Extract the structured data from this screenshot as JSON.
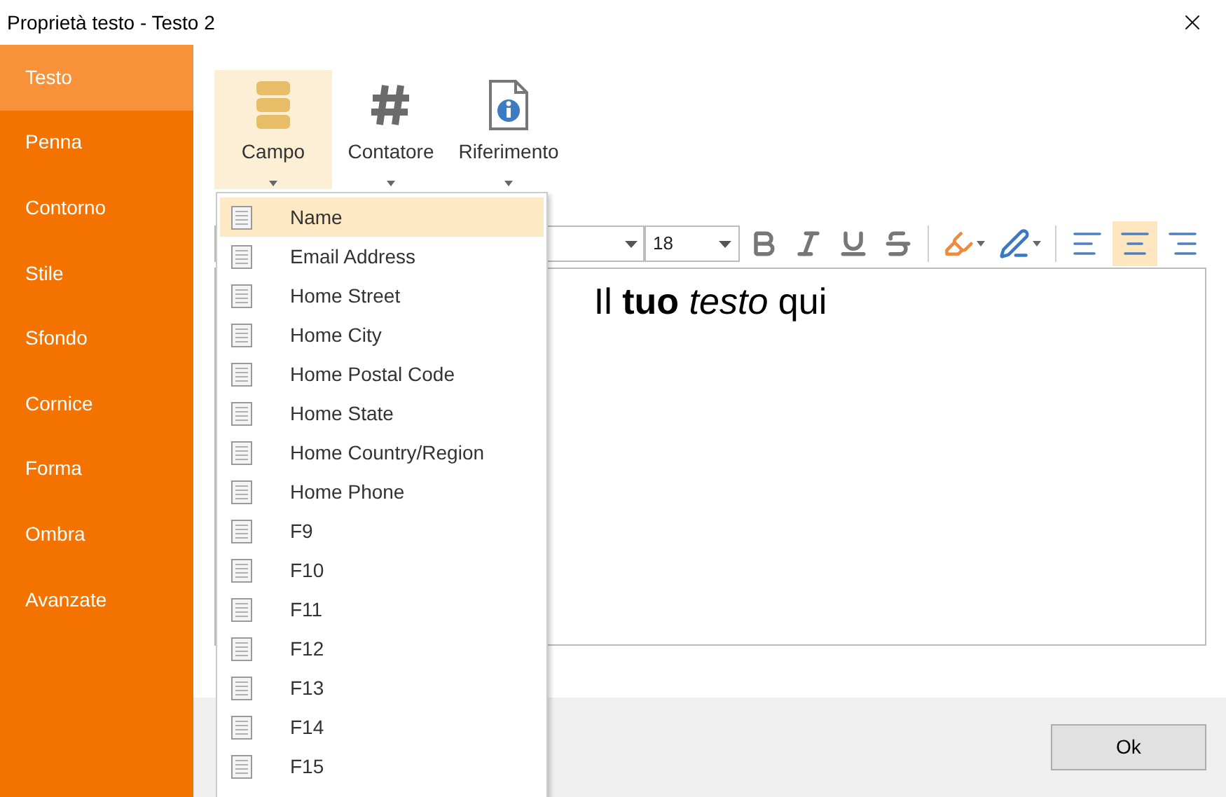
{
  "window": {
    "title": "Proprietà testo - Testo 2"
  },
  "sidebar": {
    "items": [
      {
        "label": "Testo",
        "selected": true
      },
      {
        "label": "Penna",
        "selected": false
      },
      {
        "label": "Contorno",
        "selected": false
      },
      {
        "label": "Stile",
        "selected": false
      },
      {
        "label": "Sfondo",
        "selected": false
      },
      {
        "label": "Cornice",
        "selected": false
      },
      {
        "label": "Forma",
        "selected": false
      },
      {
        "label": "Ombra",
        "selected": false
      },
      {
        "label": "Avanzate",
        "selected": false
      }
    ]
  },
  "ribbon": {
    "buttons": [
      {
        "label": "Campo",
        "kind": "field",
        "selected": true
      },
      {
        "label": "Contatore",
        "kind": "counter",
        "selected": false
      },
      {
        "label": "Riferimento",
        "kind": "reference",
        "selected": false
      }
    ]
  },
  "toolbar": {
    "font_size": "18",
    "format_buttons": [
      {
        "kind": "bold"
      },
      {
        "kind": "italic"
      },
      {
        "kind": "underline"
      },
      {
        "kind": "strike"
      }
    ],
    "color_buttons": [
      {
        "kind": "highlight"
      },
      {
        "kind": "pen"
      }
    ],
    "align_buttons": [
      {
        "kind": "left",
        "selected": false
      },
      {
        "kind": "center",
        "selected": true
      },
      {
        "kind": "right",
        "selected": false
      }
    ]
  },
  "editor": {
    "text": "Il **tuo** *testo* qui"
  },
  "field_menu": {
    "items": [
      {
        "label": "Name",
        "selected": true
      },
      {
        "label": "Email Address",
        "selected": false
      },
      {
        "label": "Home Street",
        "selected": false
      },
      {
        "label": "Home City",
        "selected": false
      },
      {
        "label": "Home Postal Code",
        "selected": false
      },
      {
        "label": "Home State",
        "selected": false
      },
      {
        "label": "Home Country/Region",
        "selected": false
      },
      {
        "label": "Home Phone",
        "selected": false
      },
      {
        "label": "F9",
        "selected": false
      },
      {
        "label": "F10",
        "selected": false
      },
      {
        "label": "F11",
        "selected": false
      },
      {
        "label": "F12",
        "selected": false
      },
      {
        "label": "F13",
        "selected": false
      },
      {
        "label": "F14",
        "selected": false
      },
      {
        "label": "F15",
        "selected": false
      }
    ]
  },
  "footer": {
    "ok_button": "Ok"
  }
}
